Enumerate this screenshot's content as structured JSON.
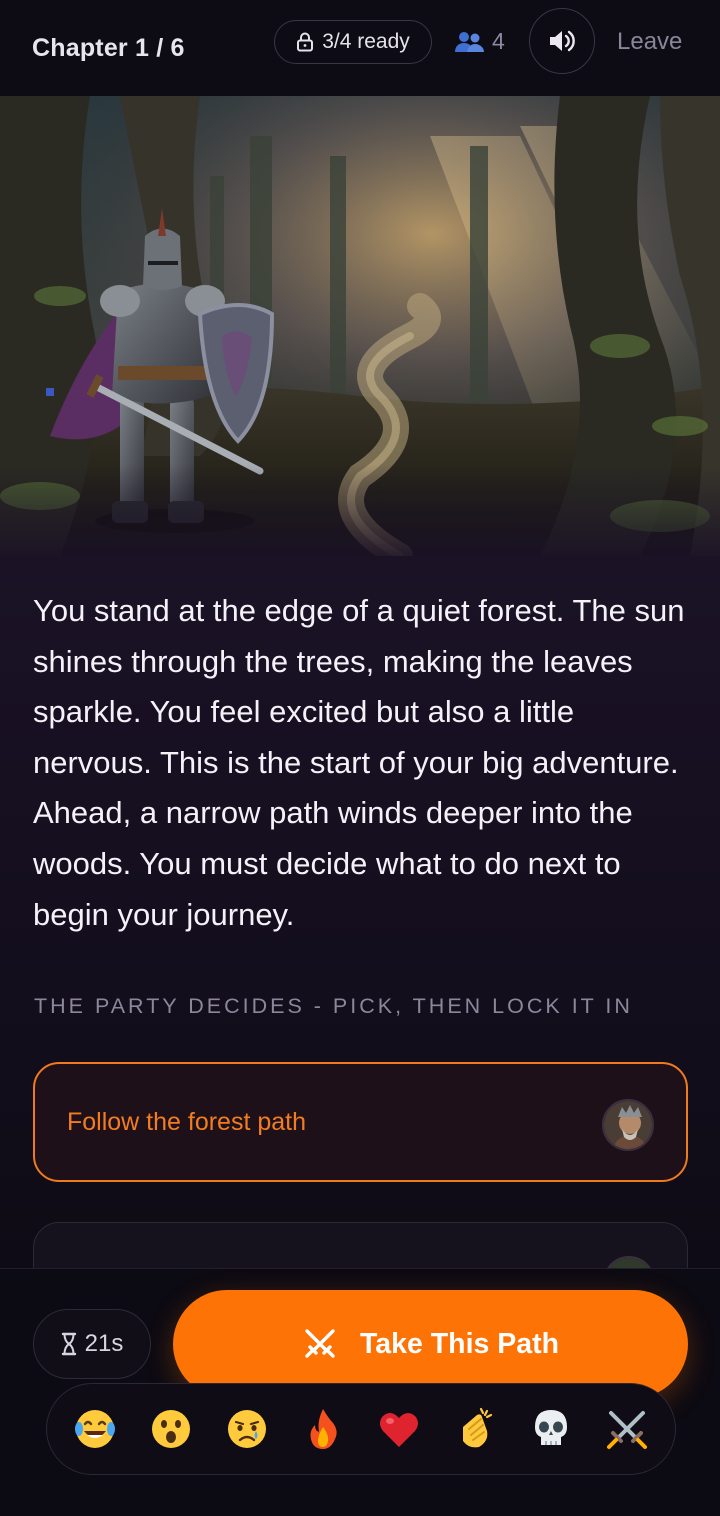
{
  "header": {
    "chapter": "Chapter 1 / 6",
    "ready_status": "3/4 ready",
    "players_count": "4",
    "sound_icon": "speaker-icon",
    "leave_label": "Leave"
  },
  "scene": {
    "image_subject": "armored knight with shield and sword at the edge of a misty forest path"
  },
  "story": {
    "text": "You stand at the edge of a quiet forest. The sun shines through the trees, making the leaves sparkle. You feel excited but also a little nervous. This is the start of your big adventure. Ahead, a narrow path winds deeper into the woods. You must decide what to do next to begin your journey."
  },
  "decision": {
    "label": "THE PARTY DECIDES - PICK, THEN LOCK IT IN",
    "choices": [
      {
        "text": "Follow the forest path",
        "selected": true
      },
      {
        "text": "",
        "selected": false
      }
    ]
  },
  "footer": {
    "timer": "21s",
    "take_path_label": "Take This Path",
    "reactions": [
      "tears-of-joy",
      "astonished",
      "crying",
      "fire",
      "heart",
      "clapping",
      "skull",
      "crossed-swords"
    ]
  },
  "colors": {
    "accent": "#fe7305",
    "background": "#0c0a14",
    "selected_text": "#f27c20"
  }
}
